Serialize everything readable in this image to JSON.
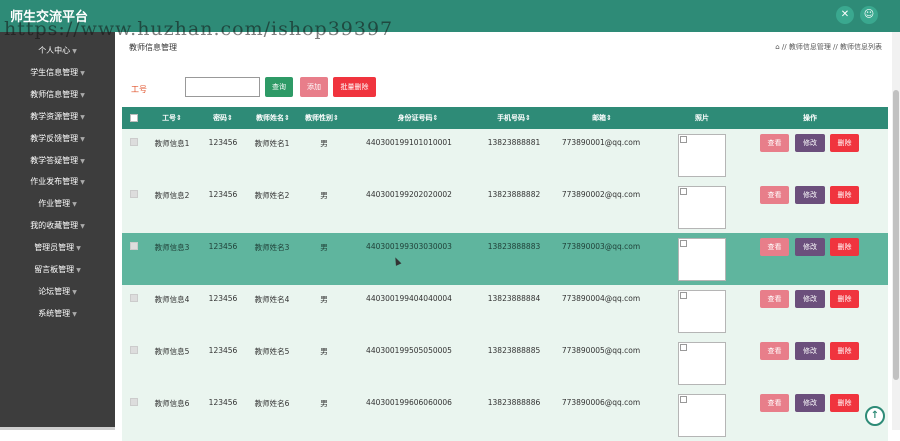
{
  "header": {
    "app_title": "师生交流平台",
    "watermark": "https://www.huzhan.com/ishop39397",
    "icons": [
      "shuffle-icon",
      "user-icon"
    ]
  },
  "sidebar": {
    "items": [
      {
        "label": "个人中心",
        "arrow": "▼"
      },
      {
        "label": "学生信息管理",
        "arrow": "▼"
      },
      {
        "label": "教师信息管理",
        "arrow": "▼"
      },
      {
        "label": "教学资源管理",
        "arrow": "▼"
      },
      {
        "label": "教学反馈管理",
        "arrow": "▼"
      },
      {
        "label": "教学答疑管理",
        "arrow": "▼"
      },
      {
        "label": "作业发布管理",
        "arrow": "▼"
      },
      {
        "label": "作业管理",
        "arrow": "▼"
      },
      {
        "label": "我的收藏管理",
        "arrow": "▼"
      },
      {
        "label": "管理员管理",
        "arrow": "▼"
      },
      {
        "label": "留言板管理",
        "arrow": "▼"
      },
      {
        "label": "论坛管理",
        "arrow": "▼"
      },
      {
        "label": "系统管理",
        "arrow": "▼"
      }
    ]
  },
  "main": {
    "page_title": "教师信息管理",
    "breadcrumb": "⌂ // 教师信息管理 // 教师信息列表",
    "search": {
      "label": "工号",
      "value": "",
      "search_label": "查询",
      "add_label": "添加",
      "batch_delete_label": "批量删除"
    },
    "table": {
      "headers": [
        "工号⇕",
        "密码⇕",
        "教师姓名⇕",
        "教师性别⇕",
        "身份证号码⇕",
        "手机号码⇕",
        "邮箱⇕",
        "照片",
        "操作"
      ],
      "actions": {
        "view": "查看",
        "edit": "修改",
        "delete": "删除"
      },
      "rows": [
        {
          "id": "教师信息1",
          "password": "123456",
          "name": "教师姓名1",
          "gender": "男",
          "idcard": "440300199101010001",
          "phone": "13823888881",
          "email": "773890001@qq.com"
        },
        {
          "id": "教师信息2",
          "password": "123456",
          "name": "教师姓名2",
          "gender": "男",
          "idcard": "440300199202020002",
          "phone": "13823888882",
          "email": "773890002@qq.com"
        },
        {
          "id": "教师信息3",
          "password": "123456",
          "name": "教师姓名3",
          "gender": "男",
          "idcard": "440300199303030003",
          "phone": "13823888883",
          "email": "773890003@qq.com"
        },
        {
          "id": "教师信息4",
          "password": "123456",
          "name": "教师姓名4",
          "gender": "男",
          "idcard": "440300199404040004",
          "phone": "13823888884",
          "email": "773890004@qq.com"
        },
        {
          "id": "教师信息5",
          "password": "123456",
          "name": "教师姓名5",
          "gender": "男",
          "idcard": "440300199505050005",
          "phone": "13823888885",
          "email": "773890005@qq.com"
        },
        {
          "id": "教师信息6",
          "password": "123456",
          "name": "教师姓名6",
          "gender": "男",
          "idcard": "440300199606060006",
          "phone": "13823888886",
          "email": "773890006@qq.com"
        }
      ]
    }
  },
  "colors": {
    "primary": "#2e8b77",
    "row_selected": "#5fb59e",
    "row_bg": "#eaf5ef",
    "view_button": "#e87e8a",
    "edit_button": "#6b4f7c",
    "delete_button": "#f0343e",
    "search_button": "#2e9a66"
  }
}
